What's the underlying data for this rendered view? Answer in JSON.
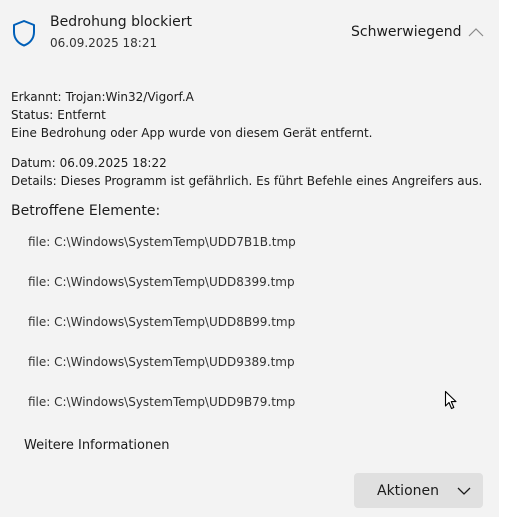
{
  "header": {
    "title": "Bedrohung blockiert",
    "timestamp": "06.09.2025 18:21",
    "severity": "Schwerwiegend",
    "icon": "shield-icon",
    "collapse_icon": "chevron-up-icon"
  },
  "details": {
    "detected_label": "Erkannt:",
    "detected_value": "Trojan:Win32/Vigorf.A",
    "status_label": "Status:",
    "status_value": "Entfernt",
    "description": "Eine Bedrohung oder App wurde von diesem Gerät entfernt.",
    "date_label": "Datum:",
    "date_value": "06.09.2025 18:22",
    "details_label": "Details:",
    "details_value": "Dieses Programm ist gefährlich. Es führt Befehle eines Angreifers aus."
  },
  "affected": {
    "title": "Betroffene Elemente:",
    "items": [
      "file: C:\\Windows\\SystemTemp\\UDD7B1B.tmp",
      "file: C:\\Windows\\SystemTemp\\UDD8399.tmp",
      "file: C:\\Windows\\SystemTemp\\UDD8B99.tmp",
      "file: C:\\Windows\\SystemTemp\\UDD9389.tmp",
      "file: C:\\Windows\\SystemTemp\\UDD9B79.tmp"
    ]
  },
  "more_info": "Weitere Informationen",
  "actions": {
    "label": "Aktionen",
    "icon": "chevron-down-icon"
  },
  "colors": {
    "accent": "#005fb8",
    "panel_bg": "#f3f3f3",
    "button_bg": "#e0e0e0"
  }
}
